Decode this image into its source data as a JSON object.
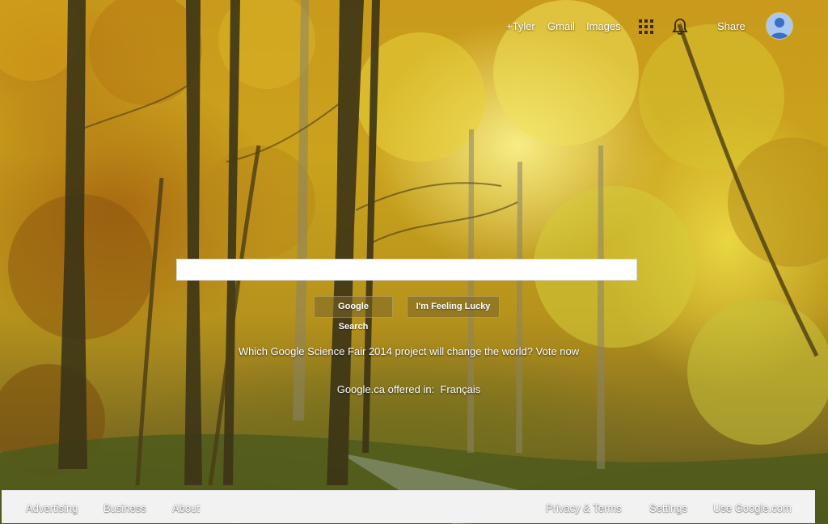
{
  "header": {
    "links": {
      "plus_user": "+Tyler",
      "gmail": "Gmail",
      "images": "Images",
      "share": "Share"
    },
    "icons": {
      "apps": "apps-grid-icon",
      "notifications": "bell-icon",
      "account": "avatar-icon"
    }
  },
  "search": {
    "value": "",
    "placeholder": ""
  },
  "buttons": {
    "search": "Google Search",
    "lucky": "I'm Feeling Lucky"
  },
  "promo": {
    "text": "Which Google Science Fair 2014 project will change the world?",
    "link": "Vote now"
  },
  "language": {
    "prefix": "Google.ca offered in:",
    "option": "Français"
  },
  "footer": {
    "left": [
      "Advertising",
      "Business",
      "About"
    ],
    "right": [
      "Privacy & Terms",
      "Settings",
      "Use Google.com"
    ]
  },
  "colors": {
    "footer_bg": "#f2f2f2",
    "autumn_gold": "#c99a1c",
    "text": "#ffffff"
  }
}
